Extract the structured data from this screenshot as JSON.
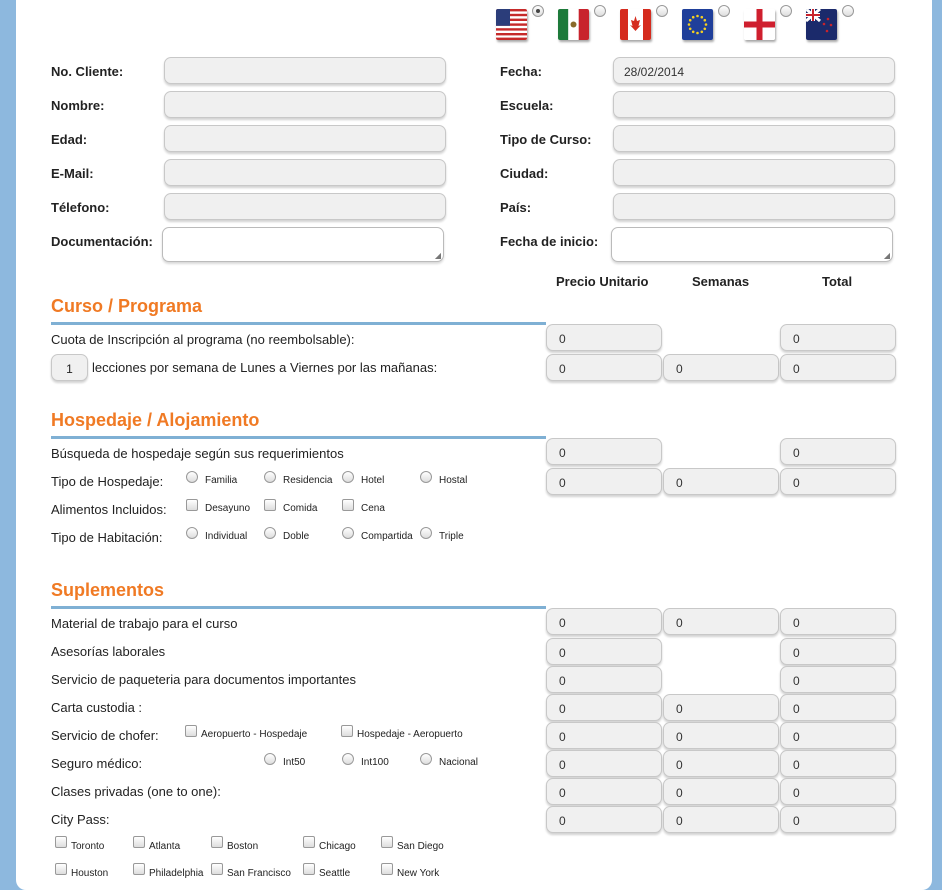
{
  "languages": [
    {
      "icon": "us-flag-icon",
      "selected": true
    },
    {
      "icon": "mexico-flag-icon",
      "selected": false
    },
    {
      "icon": "canada-flag-icon",
      "selected": false
    },
    {
      "icon": "eu-flag-icon",
      "selected": false
    },
    {
      "icon": "england-flag-icon",
      "selected": false
    },
    {
      "icon": "new-zealand-flag-icon",
      "selected": false
    }
  ],
  "client": {
    "no_cliente": {
      "label": "No. Cliente:",
      "value": ""
    },
    "nombre": {
      "label": "Nombre:",
      "value": ""
    },
    "edad": {
      "label": "Edad:",
      "value": ""
    },
    "email": {
      "label": "E-Mail:",
      "value": ""
    },
    "telefono": {
      "label": "Télefono:",
      "value": ""
    },
    "documentacion": {
      "label": "Documentación:",
      "value": ""
    },
    "fecha": {
      "label": "Fecha:",
      "value": "28/02/2014"
    },
    "escuela": {
      "label": "Escuela:",
      "value": ""
    },
    "tipo_curso": {
      "label": "Tipo de Curso:",
      "value": ""
    },
    "ciudad": {
      "label": "Ciudad:",
      "value": ""
    },
    "pais": {
      "label": "País:",
      "value": ""
    },
    "fecha_inicio": {
      "label": "Fecha de inicio:",
      "value": ""
    }
  },
  "columns": {
    "precio": "Precio Unitario",
    "semanas": "Semanas",
    "total": "Total"
  },
  "curso": {
    "title": "Curso / Programa",
    "cuota": {
      "label": "Cuota de Inscripción al programa (no reembolsable):",
      "precio": "0",
      "total": "0"
    },
    "lecciones": {
      "count": "1",
      "label": "lecciones por semana de Lunes a Viernes por las mañanas:",
      "precio": "0",
      "semanas": "0",
      "total": "0"
    }
  },
  "hospedaje": {
    "title": "Hospedaje / Alojamiento",
    "busqueda": {
      "label": "Búsqueda de hospedaje según sus requerimientos",
      "precio": "0",
      "total": "0"
    },
    "tipo": {
      "label": "Tipo de Hospedaje:",
      "options": [
        "Familia",
        "Residencia",
        "Hotel",
        "Hostal"
      ],
      "precio": "0",
      "semanas": "0",
      "total": "0"
    },
    "alimentos": {
      "label": "Alimentos Incluidos:",
      "options": [
        "Desayuno",
        "Comida",
        "Cena"
      ]
    },
    "habitacion": {
      "label": "Tipo de Habitación:",
      "options": [
        "Individual",
        "Doble",
        "Compartida",
        "Triple"
      ]
    }
  },
  "suplementos": {
    "title": "Suplementos",
    "material": {
      "label": "Material de trabajo para el curso",
      "precio": "0",
      "semanas": "0",
      "total": "0"
    },
    "asesorias": {
      "label": "Asesorías laborales",
      "precio": "0",
      "total": "0"
    },
    "paqueteria": {
      "label": "Servicio de paqueteria para documentos importantes",
      "precio": "0",
      "total": "0"
    },
    "carta": {
      "label": "Carta custodia :",
      "precio": "0",
      "semanas": "0",
      "total": "0"
    },
    "chofer": {
      "label": "Servicio de chofer:",
      "options": [
        "Aeropuerto - Hospedaje",
        "Hospedaje - Aeropuerto"
      ],
      "precio": "0",
      "semanas": "0",
      "total": "0"
    },
    "seguro": {
      "label": "Seguro médico:",
      "options": [
        "Int50",
        "Int100",
        "Nacional"
      ],
      "precio": "0",
      "semanas": "0",
      "total": "0"
    },
    "clases": {
      "label": "Clases privadas (one to one):",
      "precio": "0",
      "semanas": "0",
      "total": "0"
    },
    "citypass": {
      "label": "City Pass:",
      "precio": "0",
      "semanas": "0",
      "total": "0",
      "cities": [
        "Toronto",
        "Atlanta",
        "Boston",
        "Chicago",
        "San Diego",
        "Houston",
        "Philadelphia",
        "San Francisco",
        "Seattle",
        "New York"
      ]
    }
  }
}
